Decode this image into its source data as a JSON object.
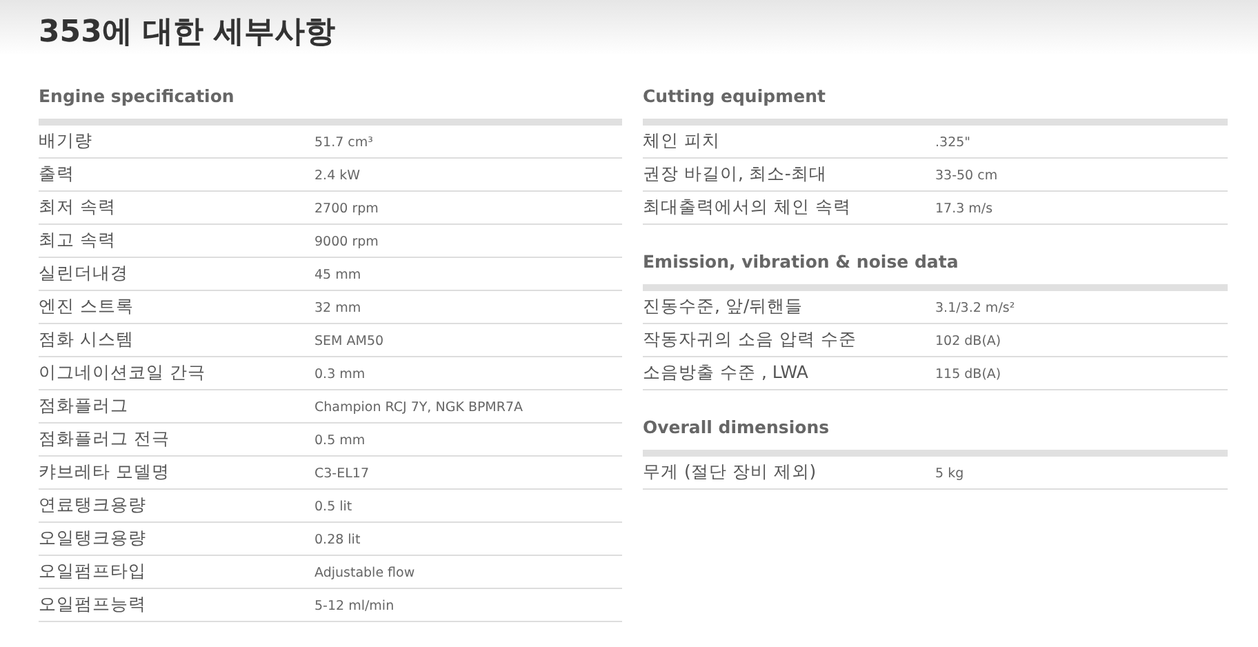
{
  "title": "353에 대한 세부사항",
  "columns": [
    [
      {
        "heading": "Engine specification",
        "rows": [
          {
            "label": "배기량",
            "value": "51.7 cm³"
          },
          {
            "label": "출력",
            "value": "2.4 kW"
          },
          {
            "label": "최저 속력",
            "value": "2700 rpm"
          },
          {
            "label": "최고 속력",
            "value": "9000 rpm"
          },
          {
            "label": "실린더내경",
            "value": "45 mm"
          },
          {
            "label": "엔진 스트록",
            "value": "32 mm"
          },
          {
            "label": "점화 시스템",
            "value": "SEM AM50"
          },
          {
            "label": "이그네이션코일 간극",
            "value": "0.3 mm"
          },
          {
            "label": "점화플러그",
            "value": "Champion RCJ 7Y, NGK BPMR7A"
          },
          {
            "label": "점화플러그 전극",
            "value": "0.5 mm"
          },
          {
            "label": "캬브레타 모델명",
            "value": "C3-EL17"
          },
          {
            "label": "연료탱크용량",
            "value": "0.5 lit"
          },
          {
            "label": "오일탱크용량",
            "value": "0.28 lit"
          },
          {
            "label": "오일펌프타입",
            "value": "Adjustable flow"
          },
          {
            "label": "오일펌프능력",
            "value": "5-12 ml/min"
          }
        ]
      }
    ],
    [
      {
        "heading": "Cutting equipment",
        "rows": [
          {
            "label": "체인 피치",
            "value": ".325\""
          },
          {
            "label": "권장 바길이, 최소-최대",
            "value": "33-50 cm"
          },
          {
            "label": "최대출력에서의 체인 속력",
            "value": "17.3 m/s"
          }
        ]
      },
      {
        "heading": "Emission, vibration & noise data",
        "rows": [
          {
            "label": "진동수준, 앞/뒤핸들",
            "value": "3.1/3.2 m/s²"
          },
          {
            "label": "작동자귀의 소음 압력 수준",
            "value": "102 dB(A)"
          },
          {
            "label": "소음방출 수준 , LWA",
            "value": "115 dB(A)"
          }
        ]
      },
      {
        "heading": "Overall dimensions",
        "rows": [
          {
            "label": "무게 (절단 장비 제외)",
            "value": "5 kg"
          }
        ]
      }
    ]
  ]
}
